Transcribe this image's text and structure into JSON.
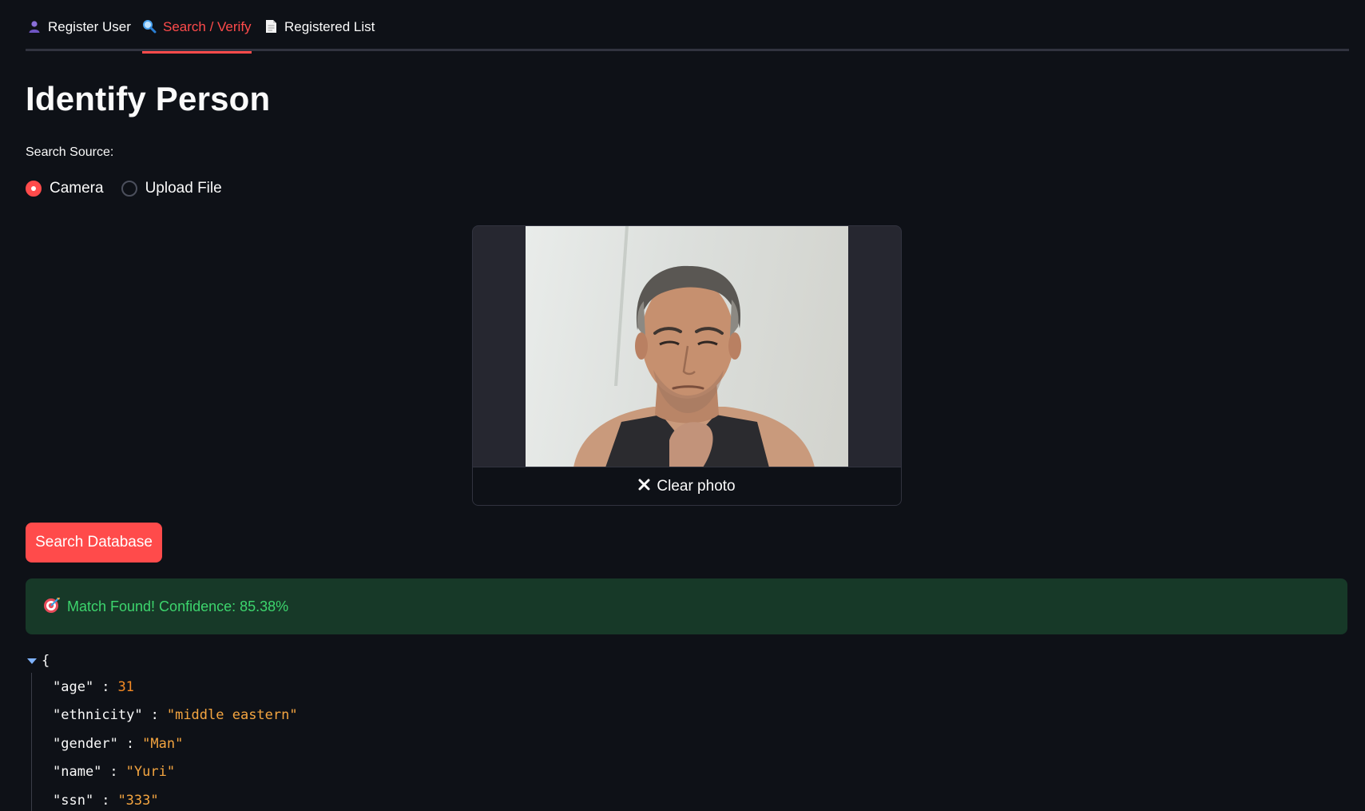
{
  "tabs": [
    {
      "label": "Register User",
      "icon": "user-silhouette-icon",
      "active": false
    },
    {
      "label": "Search / Verify",
      "icon": "magnifier-icon",
      "active": true
    },
    {
      "label": "Registered List",
      "icon": "document-icon",
      "active": false
    }
  ],
  "page": {
    "title": "Identify Person",
    "source_label": "Search Source:",
    "radio_options": [
      "Camera",
      "Upload File"
    ],
    "selected_source": "Camera"
  },
  "camera": {
    "clear_label": "Clear photo"
  },
  "actions": {
    "search_label": "Search Database"
  },
  "result": {
    "message": "Match Found! Confidence: 85.38%",
    "icon": "target-icon"
  },
  "record": [
    {
      "key": "\"age\"",
      "value": "31",
      "type": "num"
    },
    {
      "key": "\"ethnicity\"",
      "value": "\"middle eastern\"",
      "type": "str"
    },
    {
      "key": "\"gender\"",
      "value": "\"Man\"",
      "type": "str"
    },
    {
      "key": "\"name\"",
      "value": "\"Yuri\"",
      "type": "str"
    },
    {
      "key": "\"ssn\"",
      "value": "\"333\"",
      "type": "str"
    }
  ],
  "colors": {
    "accent": "#ff4b4b",
    "background": "#0e1117",
    "success_bg": "#173928",
    "success_text": "#3dd56d"
  }
}
